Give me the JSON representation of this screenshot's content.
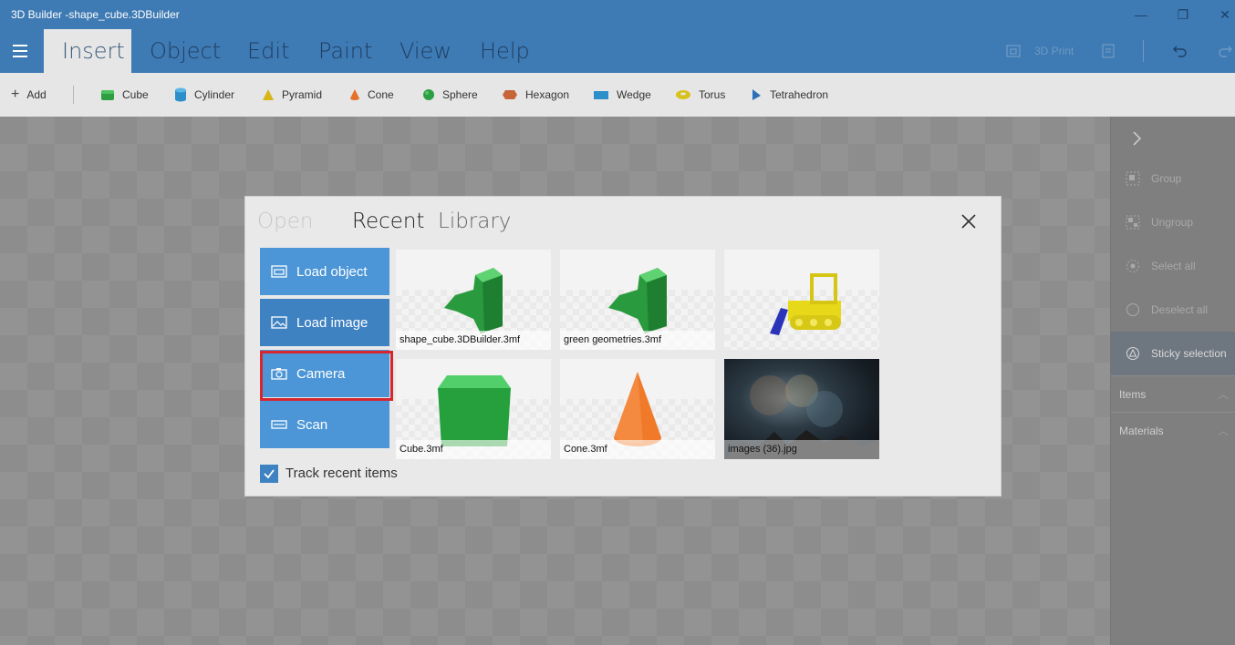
{
  "window": {
    "title": "3D Builder -shape_cube.3DBuilder",
    "controls": {
      "minimize": "—",
      "restore": "❐",
      "close": "✕"
    }
  },
  "ribbon": {
    "tabs": [
      {
        "label": "Insert"
      },
      {
        "label": "Object"
      },
      {
        "label": "Edit"
      },
      {
        "label": "Paint"
      },
      {
        "label": "View"
      },
      {
        "label": "Help"
      }
    ],
    "active_tab": "Insert",
    "print_label": "3D Print"
  },
  "shapes_bar": {
    "add_label": "Add",
    "shapes": [
      {
        "label": "Cube",
        "icon": "cube-icon",
        "color": "#2e9e43"
      },
      {
        "label": "Cylinder",
        "icon": "cylinder-icon",
        "color": "#2d8fc9"
      },
      {
        "label": "Pyramid",
        "icon": "pyramid-icon",
        "color": "#d7b618"
      },
      {
        "label": "Cone",
        "icon": "cone-icon",
        "color": "#e5702a"
      },
      {
        "label": "Sphere",
        "icon": "sphere-icon",
        "color": "#2e9e43"
      },
      {
        "label": "Hexagon",
        "icon": "hexagon-icon",
        "color": "#c7653a"
      },
      {
        "label": "Wedge",
        "icon": "wedge-icon",
        "color": "#2d8fc9"
      },
      {
        "label": "Torus",
        "icon": "torus-icon",
        "color": "#d7c21b"
      },
      {
        "label": "Tetrahedron",
        "icon": "tetrahedron-icon",
        "color": "#2d6fb9"
      }
    ]
  },
  "right_panel": {
    "items": [
      {
        "label": "Group",
        "icon": "group-icon"
      },
      {
        "label": "Ungroup",
        "icon": "ungroup-icon"
      },
      {
        "label": "Select all",
        "icon": "select-all-icon"
      },
      {
        "label": "Deselect all",
        "icon": "deselect-all-icon"
      },
      {
        "label": "Sticky selection",
        "icon": "sticky-selection-icon"
      }
    ],
    "sections": [
      {
        "label": "Items"
      },
      {
        "label": "Materials"
      }
    ]
  },
  "dialog": {
    "tabs": [
      {
        "label": "Open"
      },
      {
        "label": "Recent"
      },
      {
        "label": "Library"
      }
    ],
    "active_tab": "Recent",
    "side_buttons": [
      {
        "label": "Load object",
        "icon": "folder-icon"
      },
      {
        "label": "Load image",
        "icon": "image-icon"
      },
      {
        "label": "Camera",
        "icon": "camera-icon"
      },
      {
        "label": "Scan",
        "icon": "scanner-icon"
      }
    ],
    "recent_items": [
      {
        "caption": "shape_cube.3DBuilder.3mf"
      },
      {
        "caption": "green geometries.3mf"
      },
      {
        "caption": ""
      },
      {
        "caption": "Cube.3mf"
      },
      {
        "caption": "Cone.3mf"
      },
      {
        "caption": "images (36).jpg"
      }
    ],
    "track_recent": {
      "label": "Track recent items",
      "checked": true
    }
  },
  "colors": {
    "accent": "#3e7ab3",
    "button_blue": "#4c96d7",
    "highlight_red": "#d8262f"
  }
}
